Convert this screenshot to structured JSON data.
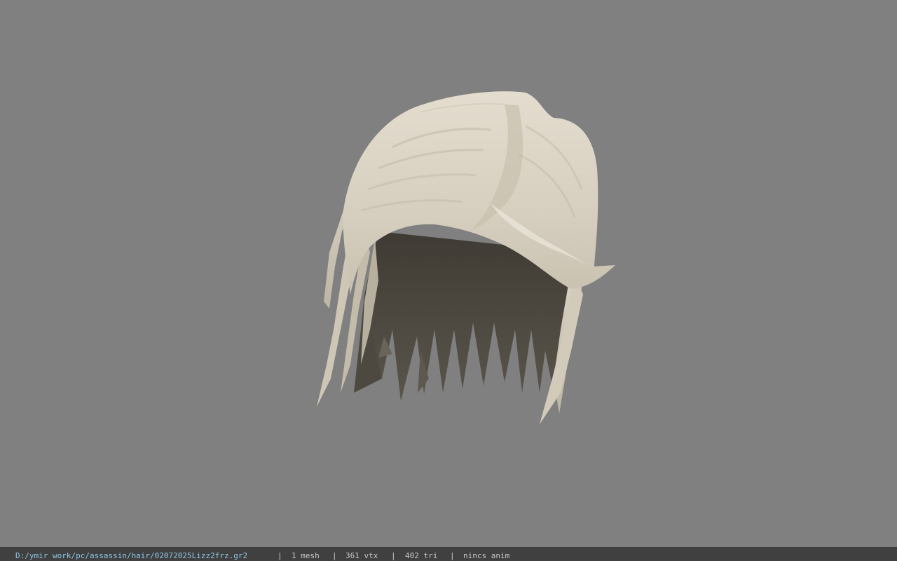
{
  "statusbar": {
    "file_path": "D:/ymir work/pc/assassin/hair/02072025Lizz2frz.gr2",
    "separator": "|",
    "mesh_count": "1 mesh",
    "vertex_count": "361 vtx",
    "triangle_count": "402 tri",
    "anim_info": "nincs anim"
  },
  "colors": {
    "viewport_background": "#808080",
    "statusbar_background": "#404040",
    "path_text": "#8ec8e6",
    "stat_text": "#c8c8c8",
    "hair_light": "#d9d2c4",
    "hair_dark": "#4a463e"
  }
}
